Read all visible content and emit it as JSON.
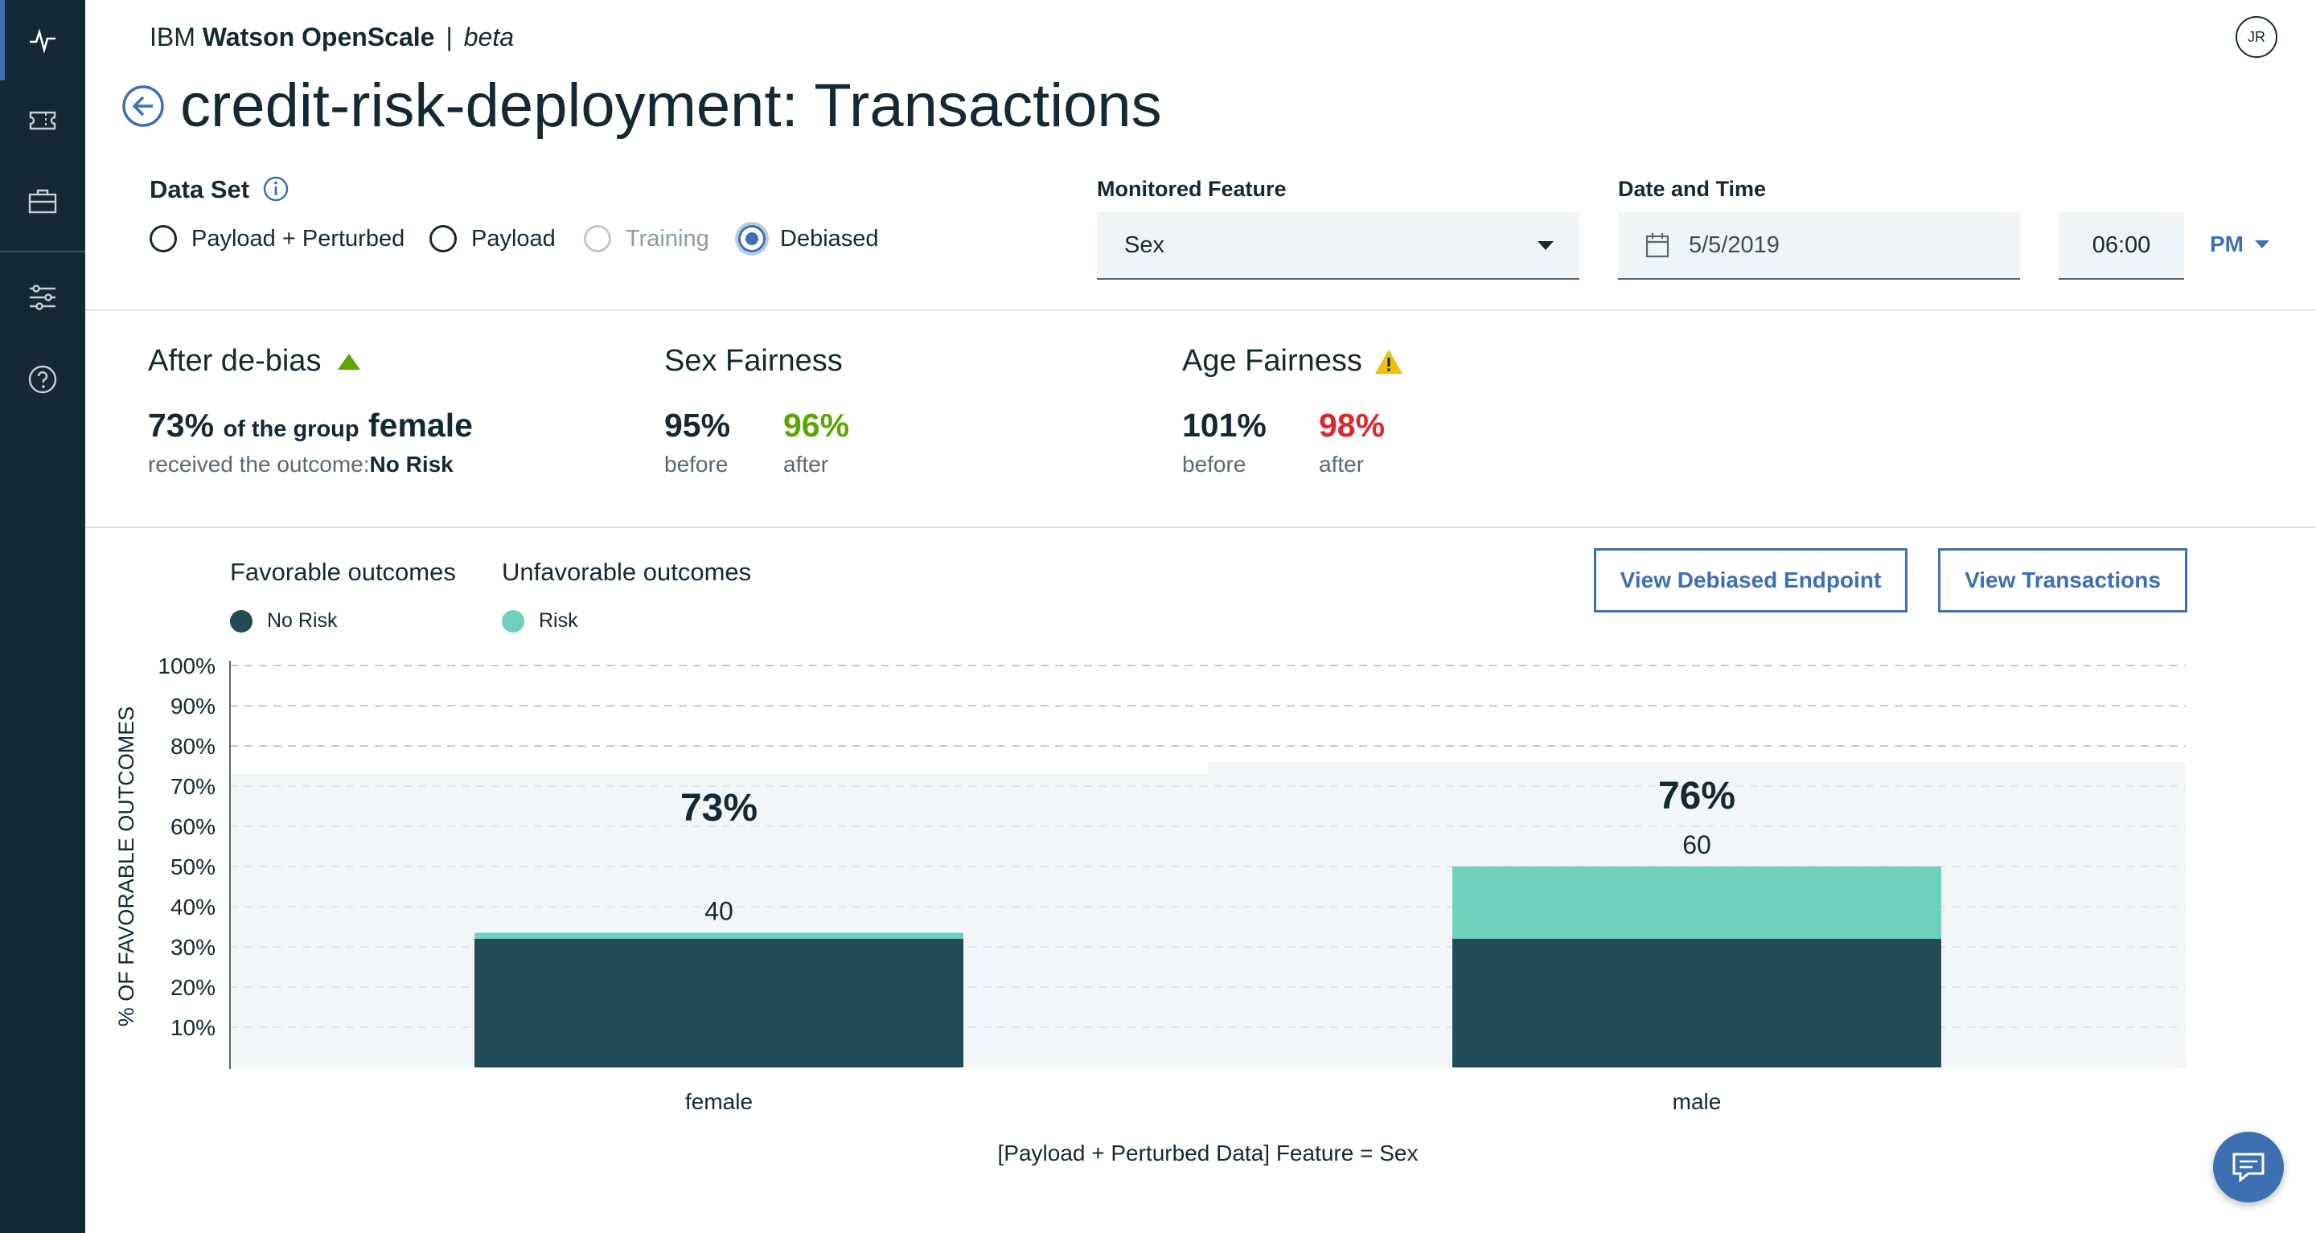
{
  "app": {
    "brand_prefix": "IBM",
    "brand_name": "Watson OpenScale",
    "separator": "|",
    "brand_tag": "beta",
    "user_initials": "JR"
  },
  "rail": {
    "items": [
      {
        "icon": "activity-icon",
        "active": true
      },
      {
        "icon": "ticket-icon",
        "active": false
      },
      {
        "icon": "briefcase-icon",
        "active": false
      },
      {
        "icon": "sliders-icon",
        "active": false
      },
      {
        "icon": "help-icon",
        "active": false
      }
    ]
  },
  "page": {
    "title": "credit-risk-deployment: Transactions"
  },
  "dataset": {
    "label": "Data Set",
    "options": [
      {
        "label": "Payload + Perturbed",
        "state": "unchecked"
      },
      {
        "label": "Payload",
        "state": "unchecked"
      },
      {
        "label": "Training",
        "state": "disabled"
      },
      {
        "label": "Debiased",
        "state": "checked"
      }
    ]
  },
  "monitored_feature": {
    "label": "Monitored Feature",
    "value": "Sex"
  },
  "date_time": {
    "label": "Date and Time",
    "date": "5/5/2019",
    "time": "06:00",
    "ampm": "PM"
  },
  "summary": {
    "debias": {
      "title": "After de-bias",
      "percent": "73%",
      "mid_text": "of the group",
      "group": "female",
      "outcome_prefix": "received the outcome:",
      "outcome": "No Risk"
    },
    "sex_fairness": {
      "title": "Sex Fairness",
      "before": "95%",
      "after": "96%",
      "before_label": "before",
      "after_label": "after"
    },
    "age_fairness": {
      "title": "Age Fairness",
      "before": "101%",
      "after": "98%",
      "before_label": "before",
      "after_label": "after"
    }
  },
  "legend": {
    "favorable_title": "Favorable outcomes",
    "unfavorable_title": "Unfavorable outcomes",
    "favorable_item": "No Risk",
    "unfavorable_item": "Risk"
  },
  "buttons": {
    "view_debiased": "View Debiased Endpoint",
    "view_transactions": "View Transactions"
  },
  "colors": {
    "favorable": "#234b55",
    "unfavorable": "#6fd0bb",
    "accent": "#3d70b2",
    "success": "#5aa700",
    "danger": "#e0262a",
    "warning": "#efc100"
  },
  "chart_data": {
    "type": "bar",
    "stacked": true,
    "categories": [
      "female",
      "male"
    ],
    "series": [
      {
        "name": "No Risk",
        "values": [
          32,
          32
        ]
      },
      {
        "name": "Risk",
        "values": [
          1.5,
          18
        ]
      }
    ],
    "totals": [
      "40",
      "60"
    ],
    "fairness_percent": [
      "73%",
      "76%"
    ],
    "fairness_band": [
      73,
      76
    ],
    "ylabel": "% OF FAVORABLE OUTCOMES",
    "xlabel": "[Payload + Perturbed Data] Feature = Sex",
    "y_ticks": [
      "10%",
      "20%",
      "30%",
      "40%",
      "50%",
      "60%",
      "70%",
      "80%",
      "90%",
      "100%"
    ],
    "ylim": [
      0,
      100
    ],
    "threshold_gridlines_dashed_above": 80,
    "grid": true
  }
}
